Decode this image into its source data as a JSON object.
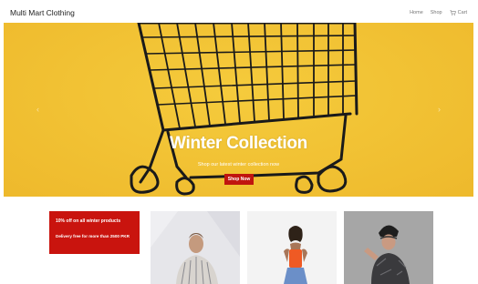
{
  "navbar": {
    "brand": "Multi Mart Clothing",
    "links": [
      "Home",
      "Shop"
    ],
    "cart_label": "Cart",
    "cart_icon": "cart-icon"
  },
  "hero": {
    "title": "Winter Collection",
    "subtitle": "Shop our latest winter collection now",
    "button_label": "Shop Now",
    "prev_icon": "chevron-left-icon",
    "next_icon": "chevron-right-icon",
    "prev_glyph": "‹",
    "next_glyph": "›",
    "background_color": "#f1c232"
  },
  "promo": {
    "title": "10% off on all winter products",
    "text": "Delivery free for more than 2500 PKR",
    "color": "#c9140e"
  },
  "products": [
    {
      "image": "man-in-striped-shirt-photo"
    },
    {
      "image": "woman-in-orange-top-photo"
    },
    {
      "image": "kid-in-beanie-jacket-photo"
    }
  ],
  "colors": {
    "accent": "#c0150f",
    "hero_yellow": "#f1c232"
  }
}
